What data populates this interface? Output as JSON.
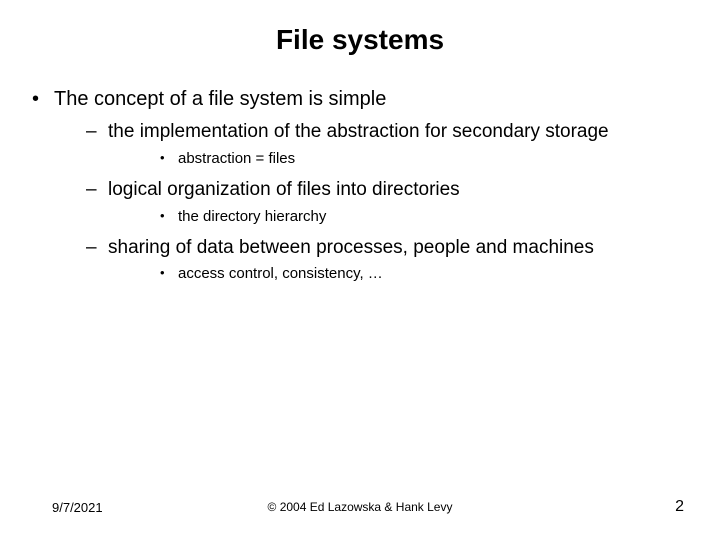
{
  "title": "File systems",
  "bullets": {
    "main": "The concept of a file system is simple",
    "sub": [
      {
        "text": "the implementation of the abstraction for secondary storage",
        "sub": [
          "abstraction = files"
        ]
      },
      {
        "text": "logical organization of files into directories",
        "sub": [
          "the directory hierarchy"
        ]
      },
      {
        "text": "sharing of data between processes, people and machines",
        "sub": [
          "access control, consistency, …"
        ]
      }
    ]
  },
  "footer": {
    "date": "9/7/2021",
    "copyright": "© 2004 Ed Lazowska & Hank Levy",
    "page": "2"
  }
}
